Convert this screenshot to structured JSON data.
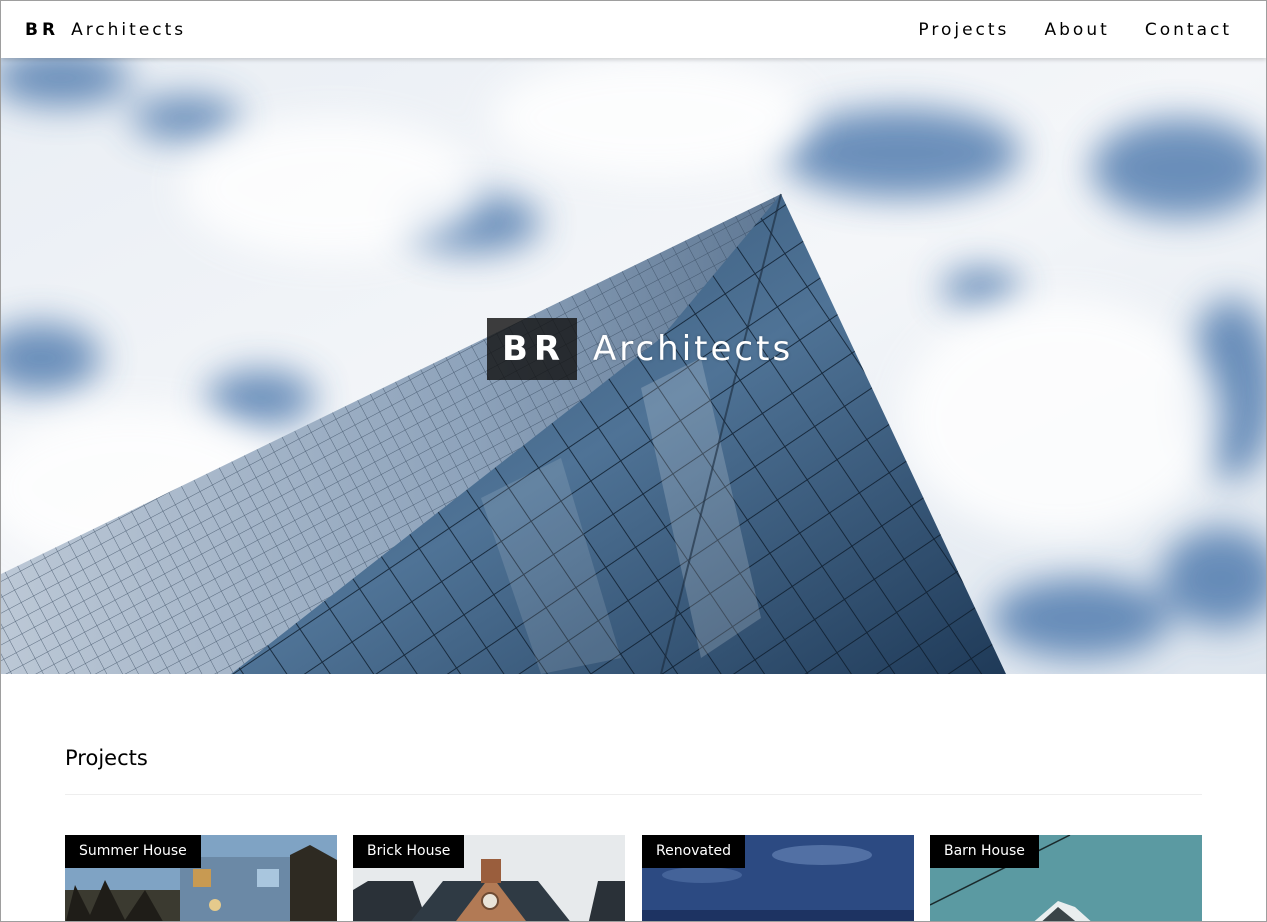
{
  "nav": {
    "brand_initials": "BR",
    "brand_name": "Architects",
    "links": [
      "Projects",
      "About",
      "Contact"
    ]
  },
  "hero": {
    "logo": "BR",
    "name": "Architects"
  },
  "projects": {
    "title": "Projects",
    "items": [
      {
        "label": "Summer House"
      },
      {
        "label": "Brick House"
      },
      {
        "label": "Renovated"
      },
      {
        "label": "Barn House"
      }
    ]
  }
}
